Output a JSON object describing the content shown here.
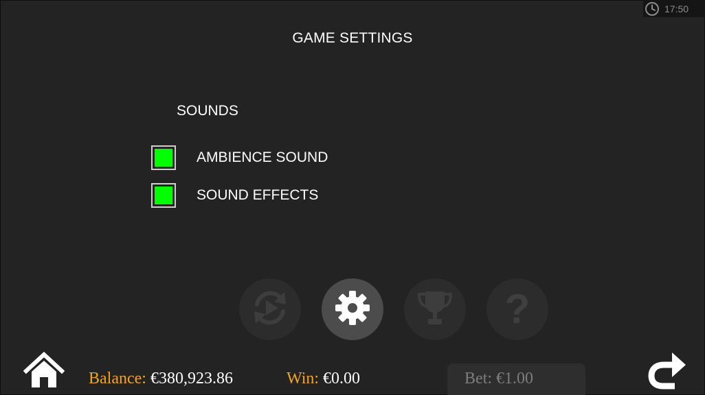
{
  "clock": {
    "icon": "clock-icon",
    "time": "17:50"
  },
  "page": {
    "title": "GAME SETTINGS"
  },
  "sounds": {
    "section_title": "SOUNDS",
    "options": [
      {
        "label": "AMBIENCE SOUND",
        "checked": true
      },
      {
        "label": "SOUND EFFECTS",
        "checked": true
      }
    ],
    "checked_color": "#00ff00"
  },
  "menu": {
    "buttons": [
      {
        "name": "autoplay",
        "icon": "autoplay-icon",
        "active": false
      },
      {
        "name": "settings",
        "icon": "gear-icon",
        "active": true
      },
      {
        "name": "trophy",
        "icon": "trophy-icon",
        "active": false
      },
      {
        "name": "help",
        "icon": "question-mark-icon",
        "glyph": "?",
        "active": false
      }
    ]
  },
  "footer": {
    "home_icon": "home-icon",
    "back_icon": "back-arrow-icon",
    "balance_label": "Balance:",
    "balance_value": "€380,923.86",
    "win_label": "Win:",
    "win_value": "€0.00",
    "bet_text": "Bet: €1.00",
    "label_color": "#f2a41c"
  }
}
